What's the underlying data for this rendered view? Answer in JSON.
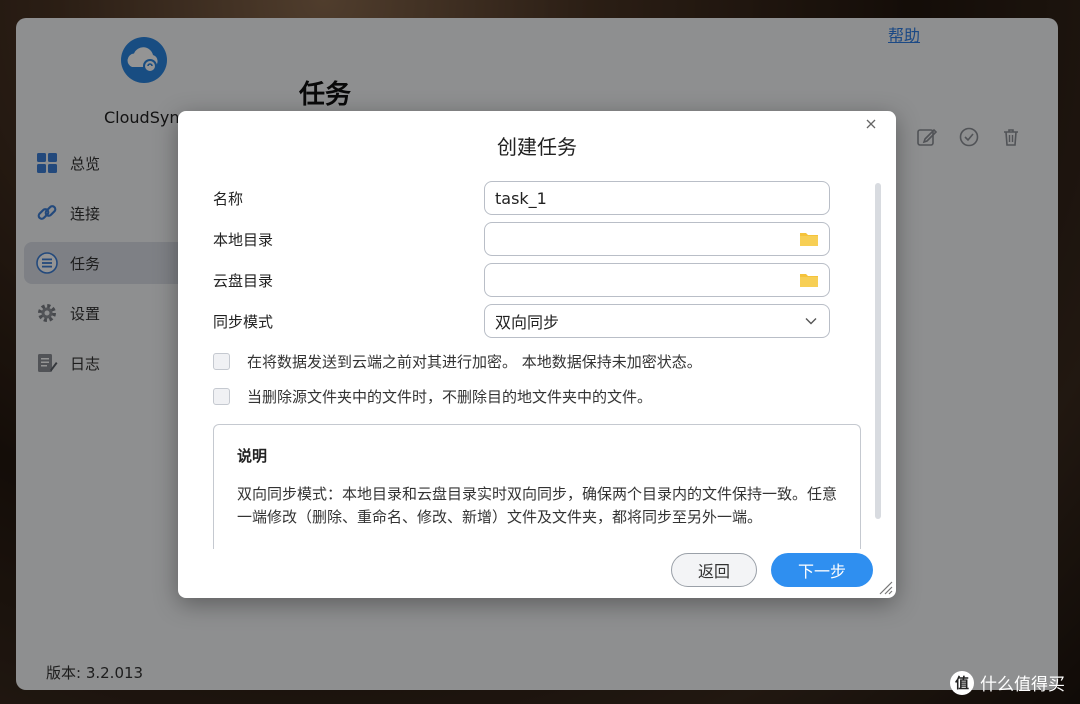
{
  "app": {
    "name": "CloudSync",
    "page_title": "任务",
    "help": "帮助",
    "version": "版本: 3.2.013"
  },
  "sidebar": {
    "items": [
      {
        "label": "总览",
        "icon": "dashboard-icon"
      },
      {
        "label": "连接",
        "icon": "link-icon"
      },
      {
        "label": "任务",
        "icon": "tasks-icon",
        "active": true
      },
      {
        "label": "设置",
        "icon": "gear-icon"
      },
      {
        "label": "日志",
        "icon": "log-icon"
      }
    ]
  },
  "toolbar": {
    "icons": [
      "edit-icon",
      "check-circle-icon",
      "trash-icon"
    ]
  },
  "dialog": {
    "title": "创建任务",
    "fields": {
      "name_label": "名称",
      "name_value": "task_1",
      "local_dir_label": "本地目录",
      "local_dir_value": "",
      "cloud_dir_label": "云盘目录",
      "cloud_dir_value": "",
      "sync_mode_label": "同步模式",
      "sync_mode_value": "双向同步"
    },
    "checkboxes": [
      {
        "label": "在将数据发送到云端之前对其进行加密。 本地数据保持未加密状态。",
        "checked": false
      },
      {
        "label": "当删除源文件夹中的文件时，不删除目的地文件夹中的文件。",
        "checked": false
      }
    ],
    "description": {
      "title": "说明",
      "text": "双向同步模式：本地目录和云盘目录实时双向同步，确保两个目录内的文件保持一致。任意一端修改（删除、重命名、修改、新增）文件及文件夹，都将同步至另外一端。"
    },
    "buttons": {
      "back": "返回",
      "next": "下一步"
    }
  },
  "watermark": {
    "icon_text": "值",
    "text": "什么值得买"
  },
  "colors": {
    "accent": "#2f8ff0",
    "folder": "#f5c33b"
  }
}
